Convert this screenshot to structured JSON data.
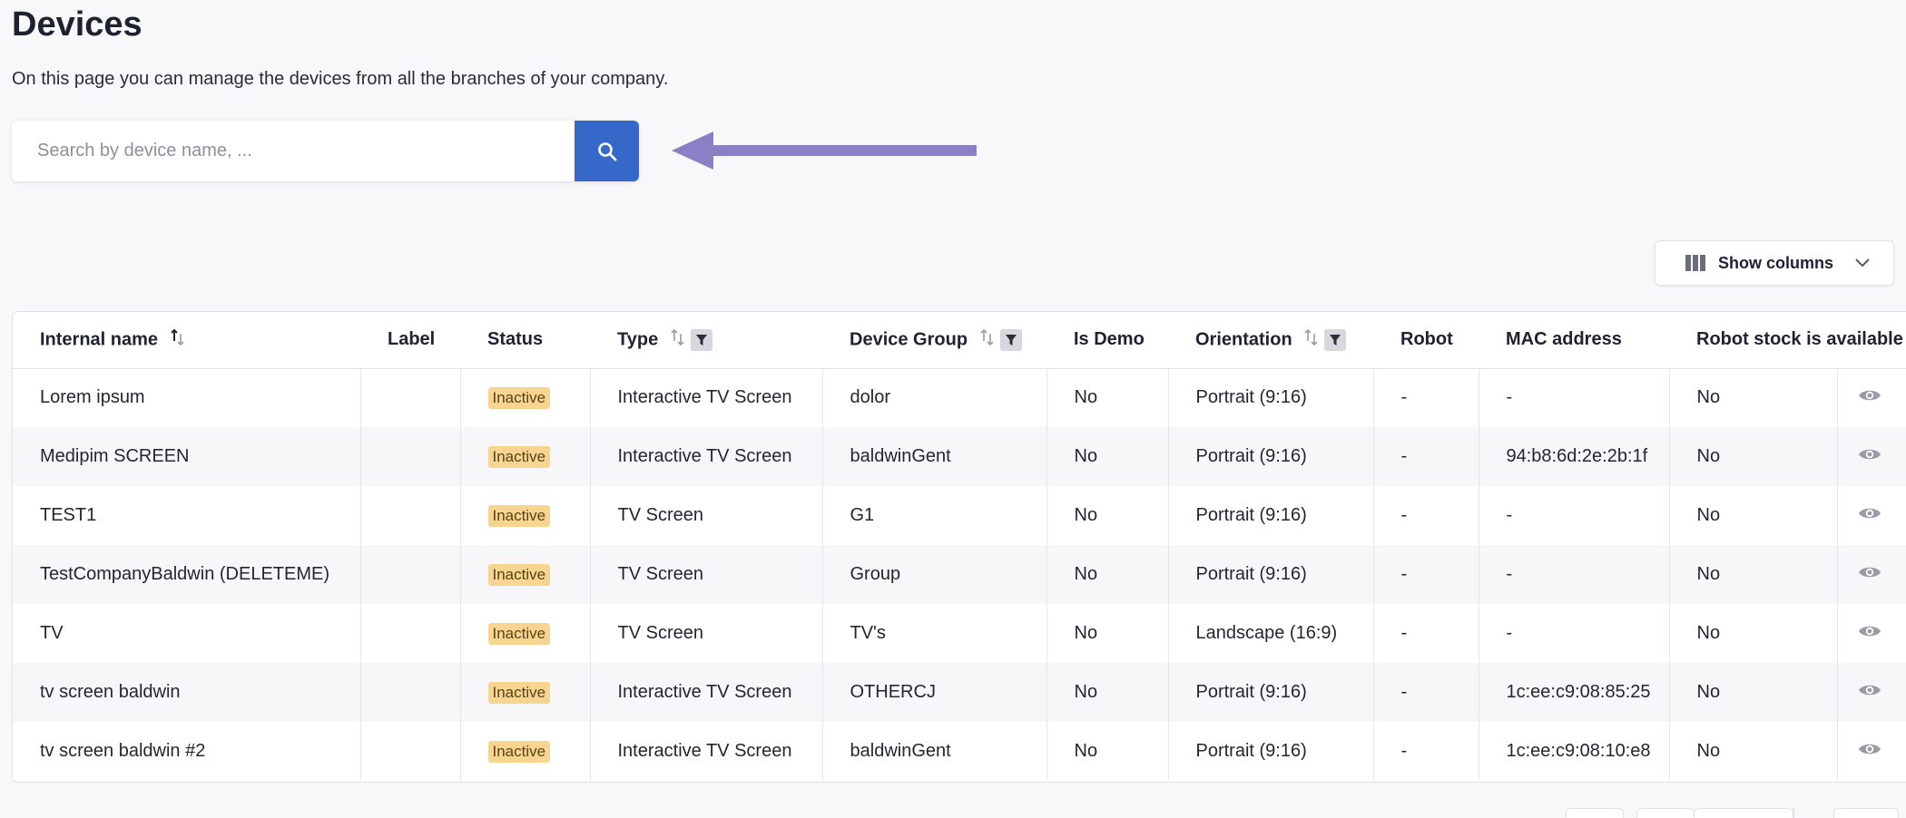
{
  "page": {
    "title": "Devices",
    "subtitle": "On this page you can manage the devices from all the branches of your company."
  },
  "search": {
    "placeholder": "Search by device name, ..."
  },
  "show_columns": {
    "label": "Show columns"
  },
  "colors": {
    "accent": "#3568c9",
    "arrow": "#8b80c6",
    "badge_bg": "#f7d48f"
  },
  "table": {
    "headers": {
      "internal_name": "Internal name",
      "label": "Label",
      "status": "Status",
      "type": "Type",
      "device_group": "Device Group",
      "is_demo": "Is Demo",
      "orientation": "Orientation",
      "robot": "Robot",
      "mac": "MAC address",
      "robot_stock": "Robot stock is available"
    },
    "rows": [
      {
        "internal_name": "Lorem ipsum",
        "label": "",
        "status": "Inactive",
        "type": "Interactive TV Screen",
        "device_group": "dolor",
        "is_demo": "No",
        "orientation": "Portrait (9:16)",
        "robot": "-",
        "mac": "-",
        "robot_stock": "No"
      },
      {
        "internal_name": "Medipim SCREEN",
        "label": "",
        "status": "Inactive",
        "type": "Interactive TV Screen",
        "device_group": "baldwinGent",
        "is_demo": "No",
        "orientation": "Portrait (9:16)",
        "robot": "-",
        "mac": "94:b8:6d:2e:2b:1f",
        "robot_stock": "No"
      },
      {
        "internal_name": "TEST1",
        "label": "",
        "status": "Inactive",
        "type": "TV Screen",
        "device_group": "G1",
        "is_demo": "No",
        "orientation": "Portrait (9:16)",
        "robot": "-",
        "mac": "-",
        "robot_stock": "No"
      },
      {
        "internal_name": "TestCompanyBaldwin (DELETEME)",
        "label": "",
        "status": "Inactive",
        "type": "TV Screen",
        "device_group": "Group",
        "is_demo": "No",
        "orientation": "Portrait (9:16)",
        "robot": "-",
        "mac": "-",
        "robot_stock": "No"
      },
      {
        "internal_name": "TV",
        "label": "",
        "status": "Inactive",
        "type": "TV Screen",
        "device_group": "TV's",
        "is_demo": "No",
        "orientation": "Landscape (16:9)",
        "robot": "-",
        "mac": "-",
        "robot_stock": "No"
      },
      {
        "internal_name": "tv screen baldwin",
        "label": "",
        "status": "Inactive",
        "type": "Interactive TV Screen",
        "device_group": "OTHERCJ",
        "is_demo": "No",
        "orientation": "Portrait (9:16)",
        "robot": "-",
        "mac": "1c:ee:c9:08:85:25",
        "robot_stock": "No"
      },
      {
        "internal_name": "tv screen baldwin #2",
        "label": "",
        "status": "Inactive",
        "type": "Interactive TV Screen",
        "device_group": "baldwinGent",
        "is_demo": "No",
        "orientation": "Portrait (9:16)",
        "robot": "-",
        "mac": "1c:ee:c9:08:10:e8",
        "robot_stock": "No"
      }
    ]
  }
}
